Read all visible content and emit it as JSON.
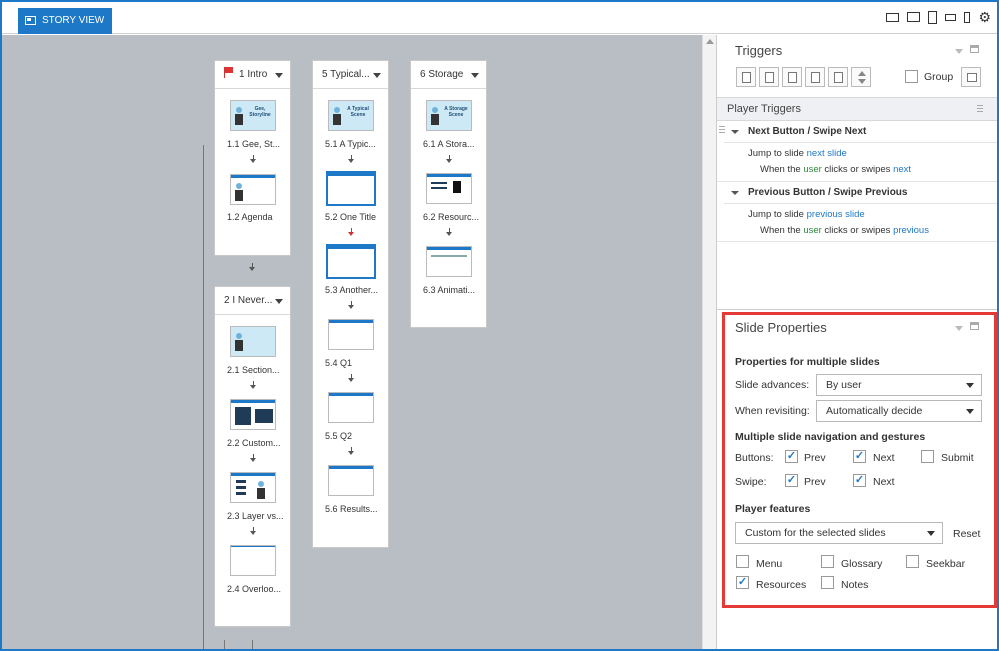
{
  "tab": {
    "label": "STORY VIEW"
  },
  "device_icons": [
    "desktop-icon",
    "tablet-landscape-icon",
    "tablet-portrait-icon",
    "phone-landscape-icon",
    "phone-portrait-icon",
    "gear-icon"
  ],
  "scenes": [
    {
      "title": "1 Intro",
      "slides": [
        "1.1 Gee, St...",
        "1.2 Agenda"
      ]
    },
    {
      "title": "2  I  Never...",
      "slides": [
        "2.1 Section...",
        "2.2 Custom...",
        "2.3 Layer vs...",
        "2.4 Overloo..."
      ]
    },
    {
      "title": "5  Typical...",
      "slides": [
        "5.1 A Typic...",
        "5.2 One Title",
        "5.3  Another...",
        "5.4 Q1",
        "5.5 Q2",
        "5.6 Results..."
      ]
    },
    {
      "title": "6 Storage",
      "slides": [
        "6.1 A Stora...",
        "6.2 Resourc...",
        "6.3 Animati..."
      ]
    }
  ],
  "thumb_text": {
    "gee": "Gee, Storyline",
    "typical": "A Typical Scene",
    "storage": "A Storage Scene"
  },
  "triggers": {
    "title": "Triggers",
    "group_label": "Group",
    "section": "Player Triggers",
    "items": [
      {
        "name": "Next Button / Swipe Next",
        "l1a": "Jump to slide ",
        "l1b": "next slide",
        "l2a": "When the ",
        "l2b": "user",
        "l2c": " clicks or swipes ",
        "l2d": "next"
      },
      {
        "name": "Previous Button / Swipe Previous",
        "l1a": "Jump to slide ",
        "l1b": "previous slide",
        "l2a": "When the ",
        "l2b": "user",
        "l2c": " clicks or swipes ",
        "l2d": "previous"
      }
    ]
  },
  "slide_properties": {
    "title": "Slide Properties",
    "multi_heading": "Properties for multiple slides",
    "advances_label": "Slide advances:",
    "advances_value": "By user",
    "revisit_label": "When revisiting:",
    "revisit_value": "Automatically decide",
    "nav_heading": "Multiple slide navigation and gestures",
    "buttons_label": "Buttons:",
    "swipe_label": "Swipe:",
    "prev": "Prev",
    "next": "Next",
    "submit": "Submit",
    "player_heading": "Player features",
    "player_value": "Custom for the selected slides",
    "reset": "Reset",
    "features": {
      "menu": "Menu",
      "glossary": "Glossary",
      "seekbar": "Seekbar",
      "resources": "Resources",
      "notes": "Notes"
    },
    "checked": {
      "buttons_prev": true,
      "buttons_next": true,
      "submit": false,
      "swipe_prev": true,
      "swipe_next": true,
      "menu": false,
      "glossary": false,
      "seekbar": false,
      "resources": true,
      "notes": false
    }
  },
  "colors": {
    "accent": "#1e78c8",
    "canvas": "#b9bdc4",
    "highlight": "#e53935"
  }
}
